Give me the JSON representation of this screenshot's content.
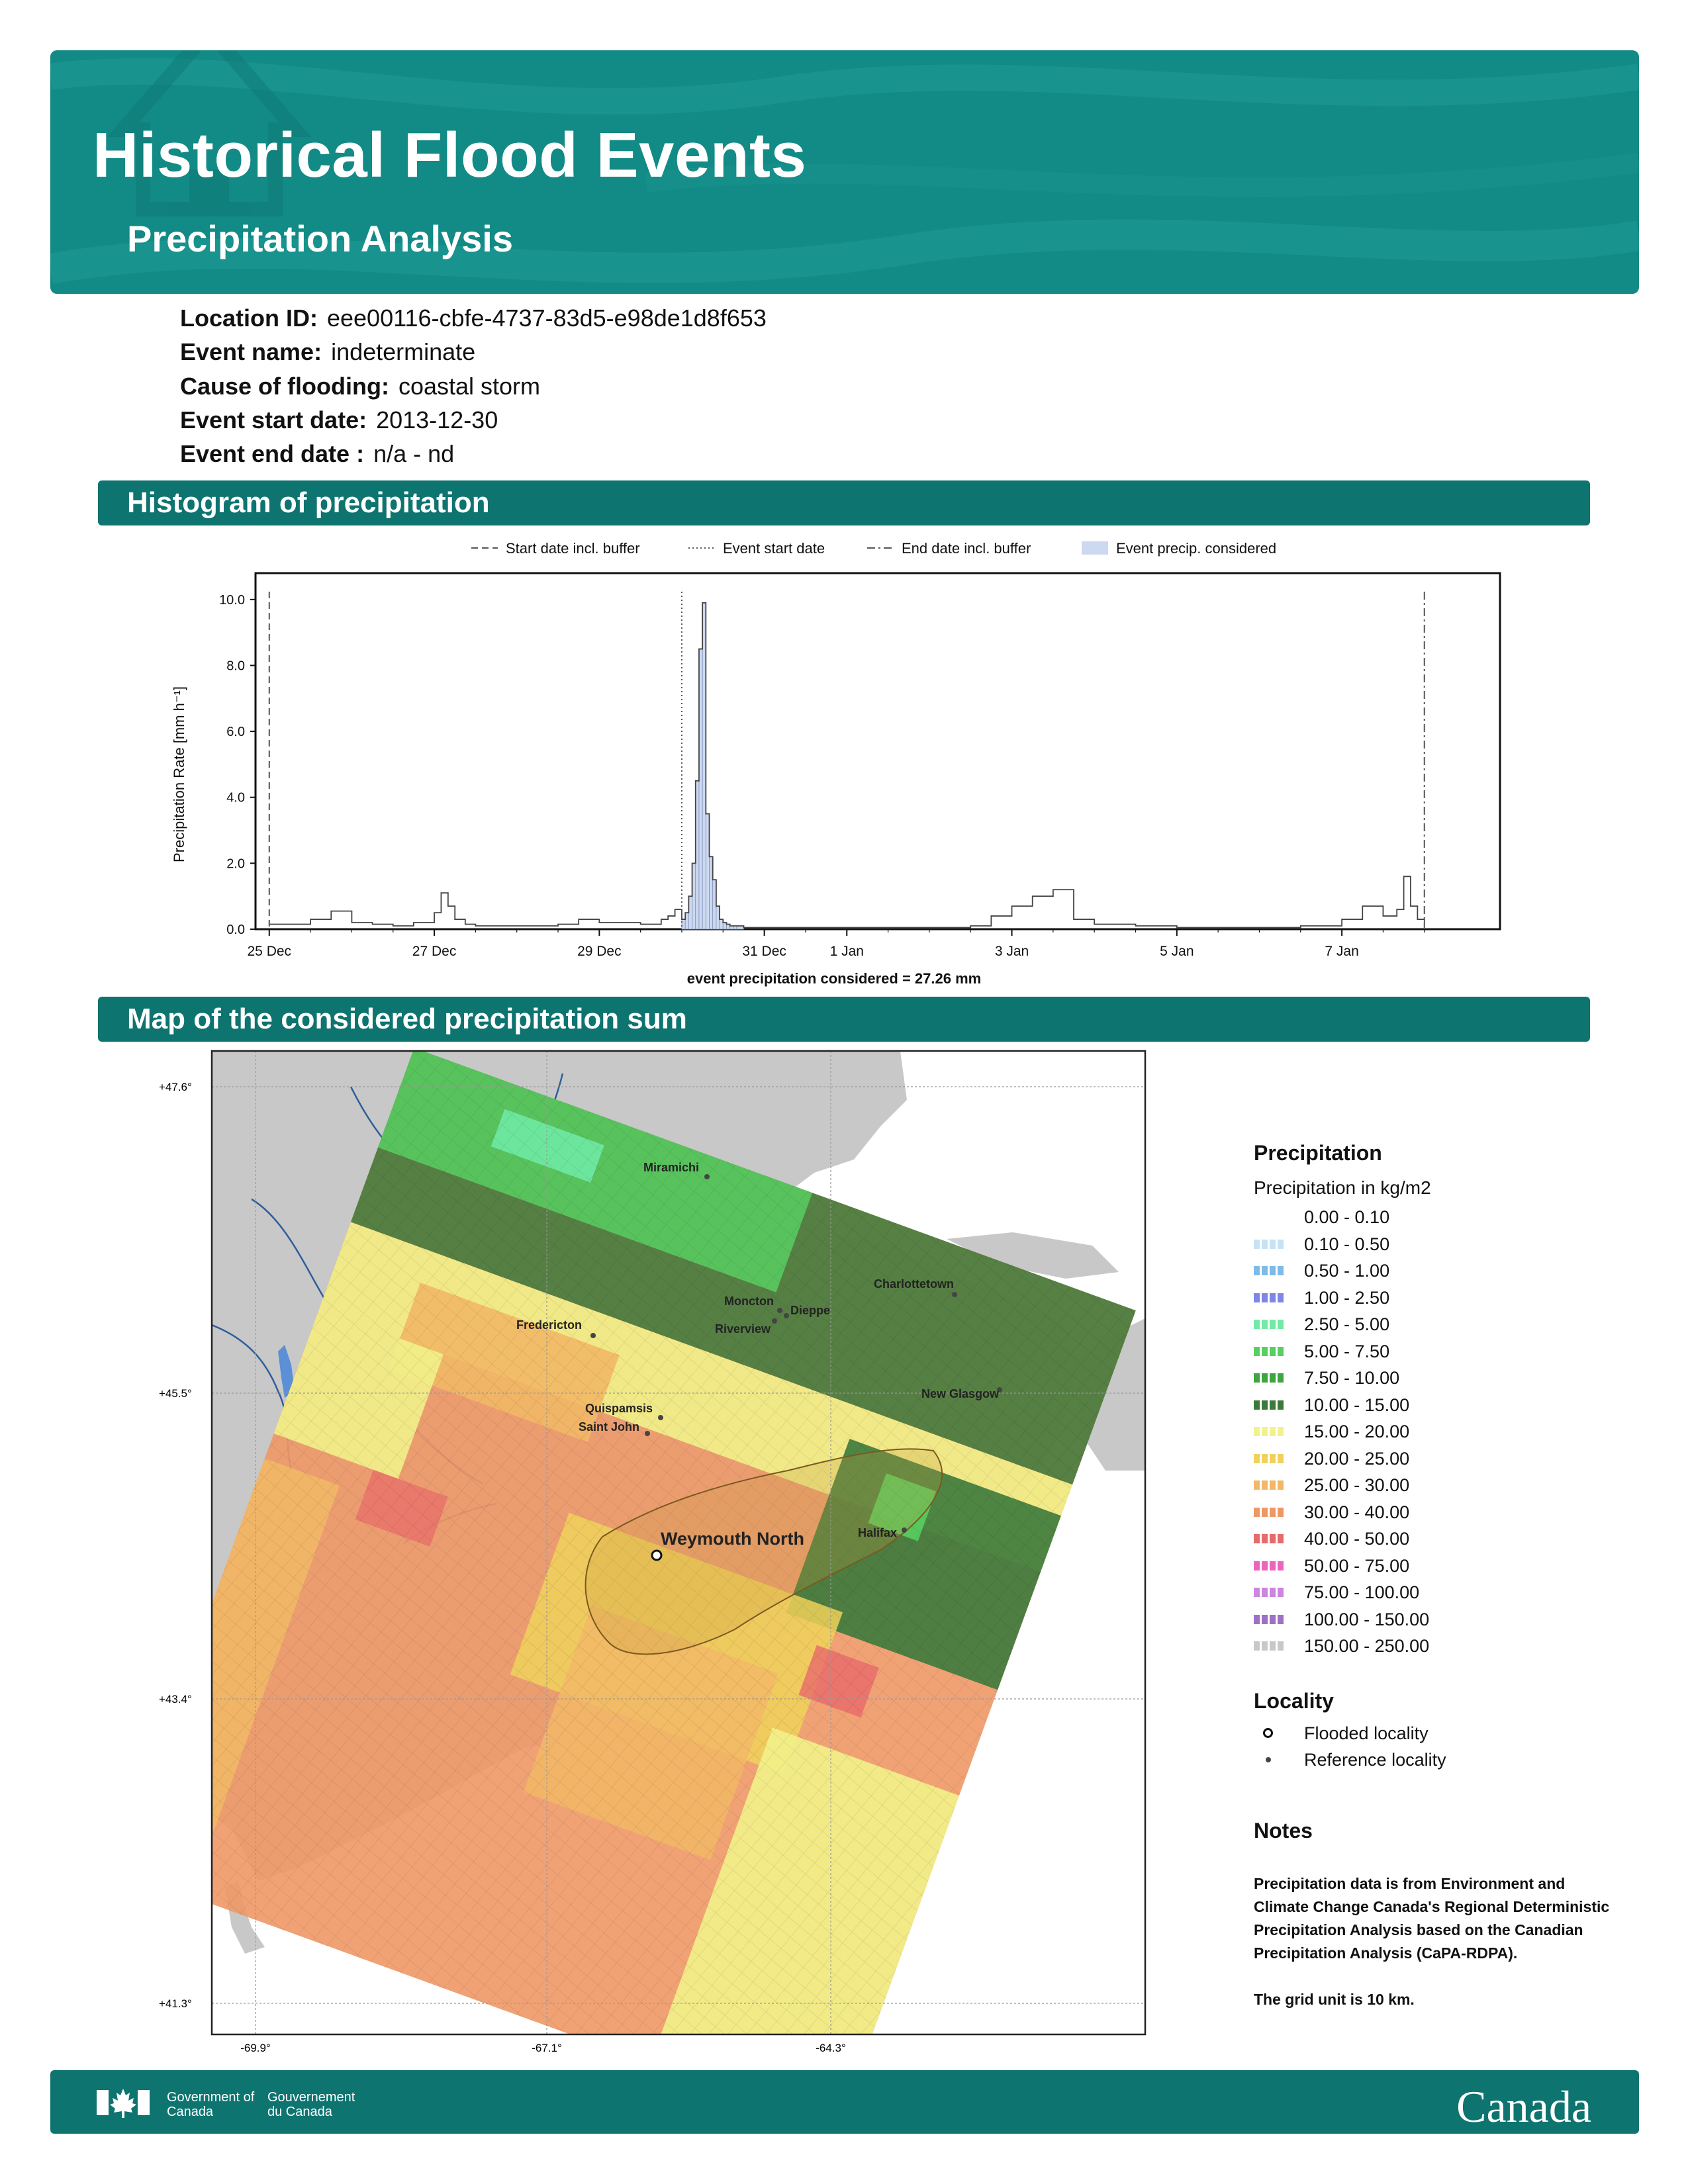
{
  "header": {
    "title": "Historical Flood Events",
    "subtitle": "Precipitation Analysis",
    "accent": "#128a86"
  },
  "event": {
    "location_id_label": "Location ID:",
    "location_id": "eee00116-cbfe-4737-83d5-e98de1d8f653",
    "name_label": "Event name:",
    "name": "indeterminate",
    "cause_label": "Cause of flooding:",
    "cause": "coastal storm",
    "start_label": "Event start date:",
    "start": "2013-12-30",
    "end_label": "Event end date :",
    "end": "n/a - nd"
  },
  "sections": {
    "histogram": "Histogram of precipitation",
    "map": "Map of the considered precipitation sum"
  },
  "chart_data": {
    "type": "bar",
    "title": "",
    "ylabel": "Precipitation Rate [mm h⁻¹]",
    "xlabel": "event precipitation considered = 27.26 mm",
    "ylim": [
      0,
      10.8
    ],
    "yticks": [
      "0.0",
      "2.0",
      "4.0",
      "6.0",
      "8.0",
      "10.0"
    ],
    "xrange": [
      "2013-12-24T20:00",
      "2014-01-08T22:00"
    ],
    "xticks": [
      {
        "label": "25 Dec",
        "date": "2013-12-25T00:00"
      },
      {
        "label": "27 Dec",
        "date": "2013-12-27T00:00"
      },
      {
        "label": "29 Dec",
        "date": "2013-12-29T00:00"
      },
      {
        "label": "31 Dec",
        "date": "2013-12-31T00:00"
      },
      {
        "label": "1 Jan",
        "date": "2014-01-01T00:00"
      },
      {
        "label": "3 Jan",
        "date": "2014-01-03T00:00"
      },
      {
        "label": "5 Jan",
        "date": "2014-01-05T00:00"
      },
      {
        "label": "7 Jan",
        "date": "2014-01-07T00:00"
      }
    ],
    "legend": [
      {
        "label": "Start date incl. buffer",
        "style": "dashed"
      },
      {
        "label": "Event start date",
        "style": "dotted"
      },
      {
        "label": "End date incl. buffer",
        "style": "dashdot"
      },
      {
        "label": "Event precip. considered",
        "style": "fill"
      }
    ],
    "markers": {
      "start_buffer": "2013-12-25T00:00",
      "event_start": "2013-12-30T00:00",
      "end_buffer": "2014-01-08T00:00"
    },
    "series": [
      {
        "x": [
          "2013-12-25T00:00",
          "2013-12-25T12:00",
          "2013-12-25T18:00",
          "2013-12-26T00:00",
          "2013-12-26T06:00",
          "2013-12-26T12:00",
          "2013-12-26T18:00",
          "2013-12-27T00:00",
          "2013-12-27T02:00",
          "2013-12-27T04:00",
          "2013-12-27T06:00",
          "2013-12-27T09:00",
          "2013-12-27T12:00",
          "2013-12-28T00:00",
          "2013-12-28T12:00",
          "2013-12-28T18:00",
          "2013-12-29T00:00",
          "2013-12-29T12:00",
          "2013-12-29T18:00",
          "2013-12-29T20:00",
          "2013-12-29T22:00",
          "2013-12-30T00:00",
          "2013-12-30T01:00",
          "2013-12-30T02:00",
          "2013-12-30T03:00",
          "2013-12-30T04:00",
          "2013-12-30T05:00",
          "2013-12-30T06:00",
          "2013-12-30T07:00",
          "2013-12-30T08:00",
          "2013-12-30T09:00",
          "2013-12-30T10:00",
          "2013-12-30T11:00",
          "2013-12-30T12:00",
          "2013-12-30T13:00",
          "2013-12-30T14:00",
          "2013-12-30T15:00",
          "2013-12-30T16:00",
          "2013-12-30T18:00",
          "2013-12-31T00:00",
          "2013-12-31T12:00",
          "2014-01-01T00:00",
          "2014-01-01T12:00",
          "2014-01-02T00:00",
          "2014-01-02T12:00",
          "2014-01-02T18:00",
          "2014-01-03T00:00",
          "2014-01-03T06:00",
          "2014-01-03T12:00",
          "2014-01-03T18:00",
          "2014-01-04T00:00",
          "2014-01-04T12:00",
          "2014-01-05T00:00",
          "2014-01-05T12:00",
          "2014-01-06T00:00",
          "2014-01-06T12:00",
          "2014-01-07T00:00",
          "2014-01-07T06:00",
          "2014-01-07T12:00",
          "2014-01-07T16:00",
          "2014-01-07T18:00",
          "2014-01-07T20:00",
          "2014-01-07T22:00",
          "2014-01-08T00:00"
        ],
        "y": [
          0.15,
          0.3,
          0.55,
          0.2,
          0.15,
          0.1,
          0.2,
          0.5,
          1.1,
          0.7,
          0.3,
          0.15,
          0.1,
          0.1,
          0.15,
          0.3,
          0.2,
          0.15,
          0.3,
          0.4,
          0.6,
          0.3,
          0.5,
          1.0,
          2.0,
          4.5,
          8.5,
          9.9,
          3.5,
          2.2,
          1.5,
          0.7,
          0.3,
          0.2,
          0.15,
          0.1,
          0.1,
          0.1,
          0.05,
          0.05,
          0.05,
          0.05,
          0.05,
          0.05,
          0.1,
          0.4,
          0.7,
          1.0,
          1.2,
          0.3,
          0.15,
          0.1,
          0.05,
          0.05,
          0.05,
          0.1,
          0.3,
          0.7,
          0.4,
          0.6,
          1.6,
          0.7,
          0.3,
          0.2
        ],
        "event_window": [
          "2013-12-30T00:00",
          "2013-12-30T18:00"
        ]
      }
    ]
  },
  "map": {
    "lat_labels": [
      "+47.6°",
      "+45.5°",
      "+43.4°",
      "+41.3°"
    ],
    "lon_labels": [
      "-69.9°",
      "-67.1°",
      "-64.3°"
    ],
    "places": [
      {
        "name": "Miramichi",
        "type": "reference"
      },
      {
        "name": "Charlottetown",
        "type": "reference"
      },
      {
        "name": "Moncton",
        "type": "reference"
      },
      {
        "name": "Dieppe",
        "type": "reference"
      },
      {
        "name": "Riverview",
        "type": "reference"
      },
      {
        "name": "Fredericton",
        "type": "reference"
      },
      {
        "name": "New Glasgow",
        "type": "reference"
      },
      {
        "name": "Quispamsis",
        "type": "reference"
      },
      {
        "name": "Saint John",
        "type": "reference"
      },
      {
        "name": "Halifax",
        "type": "reference"
      },
      {
        "name": "Weymouth North",
        "type": "flooded"
      }
    ]
  },
  "legend": {
    "title": "Precipitation",
    "subtitle": "Precipitation in kg/m2",
    "items": [
      {
        "label": "0.00 - 0.10",
        "color": "#ffffff"
      },
      {
        "label": "0.10 - 0.50",
        "color": "#c6e2f7"
      },
      {
        "label": "0.50 - 1.00",
        "color": "#7dbbe8"
      },
      {
        "label": "1.00 - 2.50",
        "color": "#7f86e6"
      },
      {
        "label": "2.50 - 5.00",
        "color": "#70eaa4"
      },
      {
        "label": "5.00 - 7.50",
        "color": "#58cf62"
      },
      {
        "label": "7.50 - 10.00",
        "color": "#3fa540"
      },
      {
        "label": "10.00 - 15.00",
        "color": "#3c7a3c"
      },
      {
        "label": "15.00 - 20.00",
        "color": "#f2f28a"
      },
      {
        "label": "20.00 - 25.00",
        "color": "#f0d25a"
      },
      {
        "label": "25.00 - 30.00",
        "color": "#f2b866"
      },
      {
        "label": "30.00 - 40.00",
        "color": "#ef9866"
      },
      {
        "label": "40.00 - 50.00",
        "color": "#e86a6a"
      },
      {
        "label": "50.00 - 75.00",
        "color": "#ec64c0"
      },
      {
        "label": "75.00 - 100.00",
        "color": "#cc86e0"
      },
      {
        "label": "100.00 - 150.00",
        "color": "#a070c2"
      },
      {
        "label": "150.00 - 250.00",
        "color": "#c8c8c8"
      }
    ],
    "locality_title": "Locality",
    "flooded_label": "Flooded locality",
    "reference_label": "Reference locality"
  },
  "notes": {
    "title": "Notes",
    "text": "Precipitation data is from Environment and Climate Change Canada's Regional Deterministic Precipitation Analysis based on the Canadian Precipitation Analysis (CaPA-RDPA).",
    "grid": "The grid unit is 10 km."
  },
  "footer": {
    "gov_en": "Government of Canada",
    "gov_fr": "Gouvernement du Canada",
    "wordmark": "Canada"
  }
}
